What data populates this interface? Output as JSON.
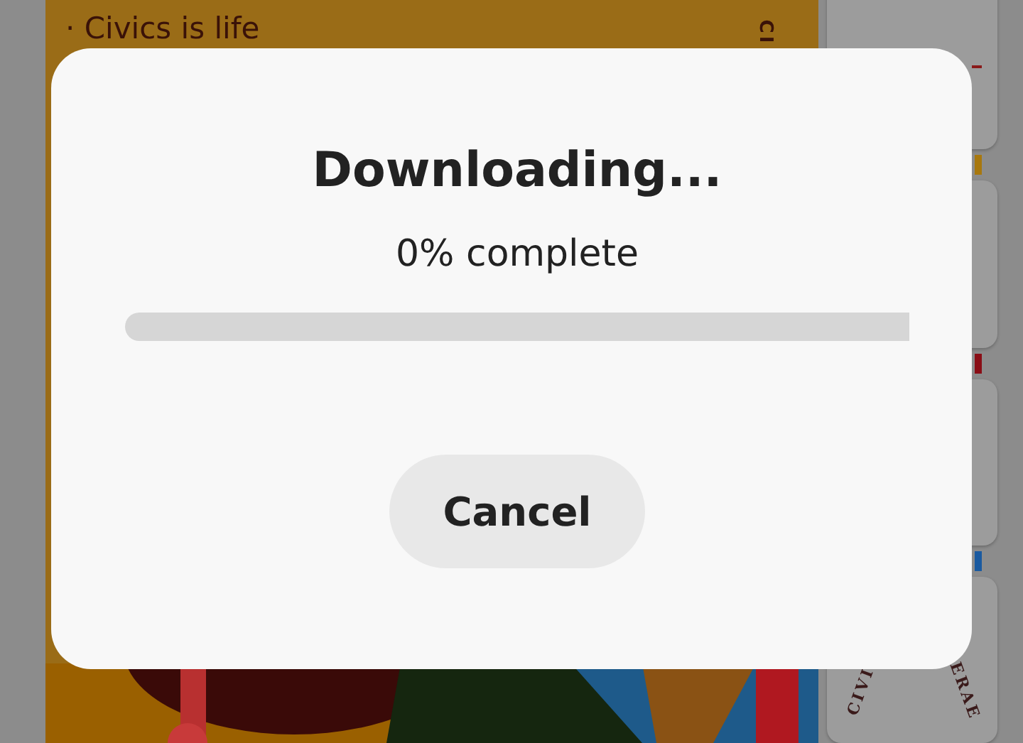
{
  "poster": {
    "heading": "· Civics is life",
    "side_text": "CI"
  },
  "thumbnails": [
    {
      "kind": "plain",
      "color": "#8a1a1a"
    },
    {
      "kind": "plain",
      "color": "#a8780e"
    },
    {
      "kind": "plain",
      "color": "#8a0e16"
    },
    {
      "kind": "seal",
      "color": "#1a5aa0",
      "left_text": "CIVI",
      "right_text": "ERAE"
    }
  ],
  "dialog": {
    "title": "Downloading...",
    "status": "0% complete",
    "progress": {
      "level": 0
    },
    "buttons": [
      "Cancel"
    ]
  }
}
